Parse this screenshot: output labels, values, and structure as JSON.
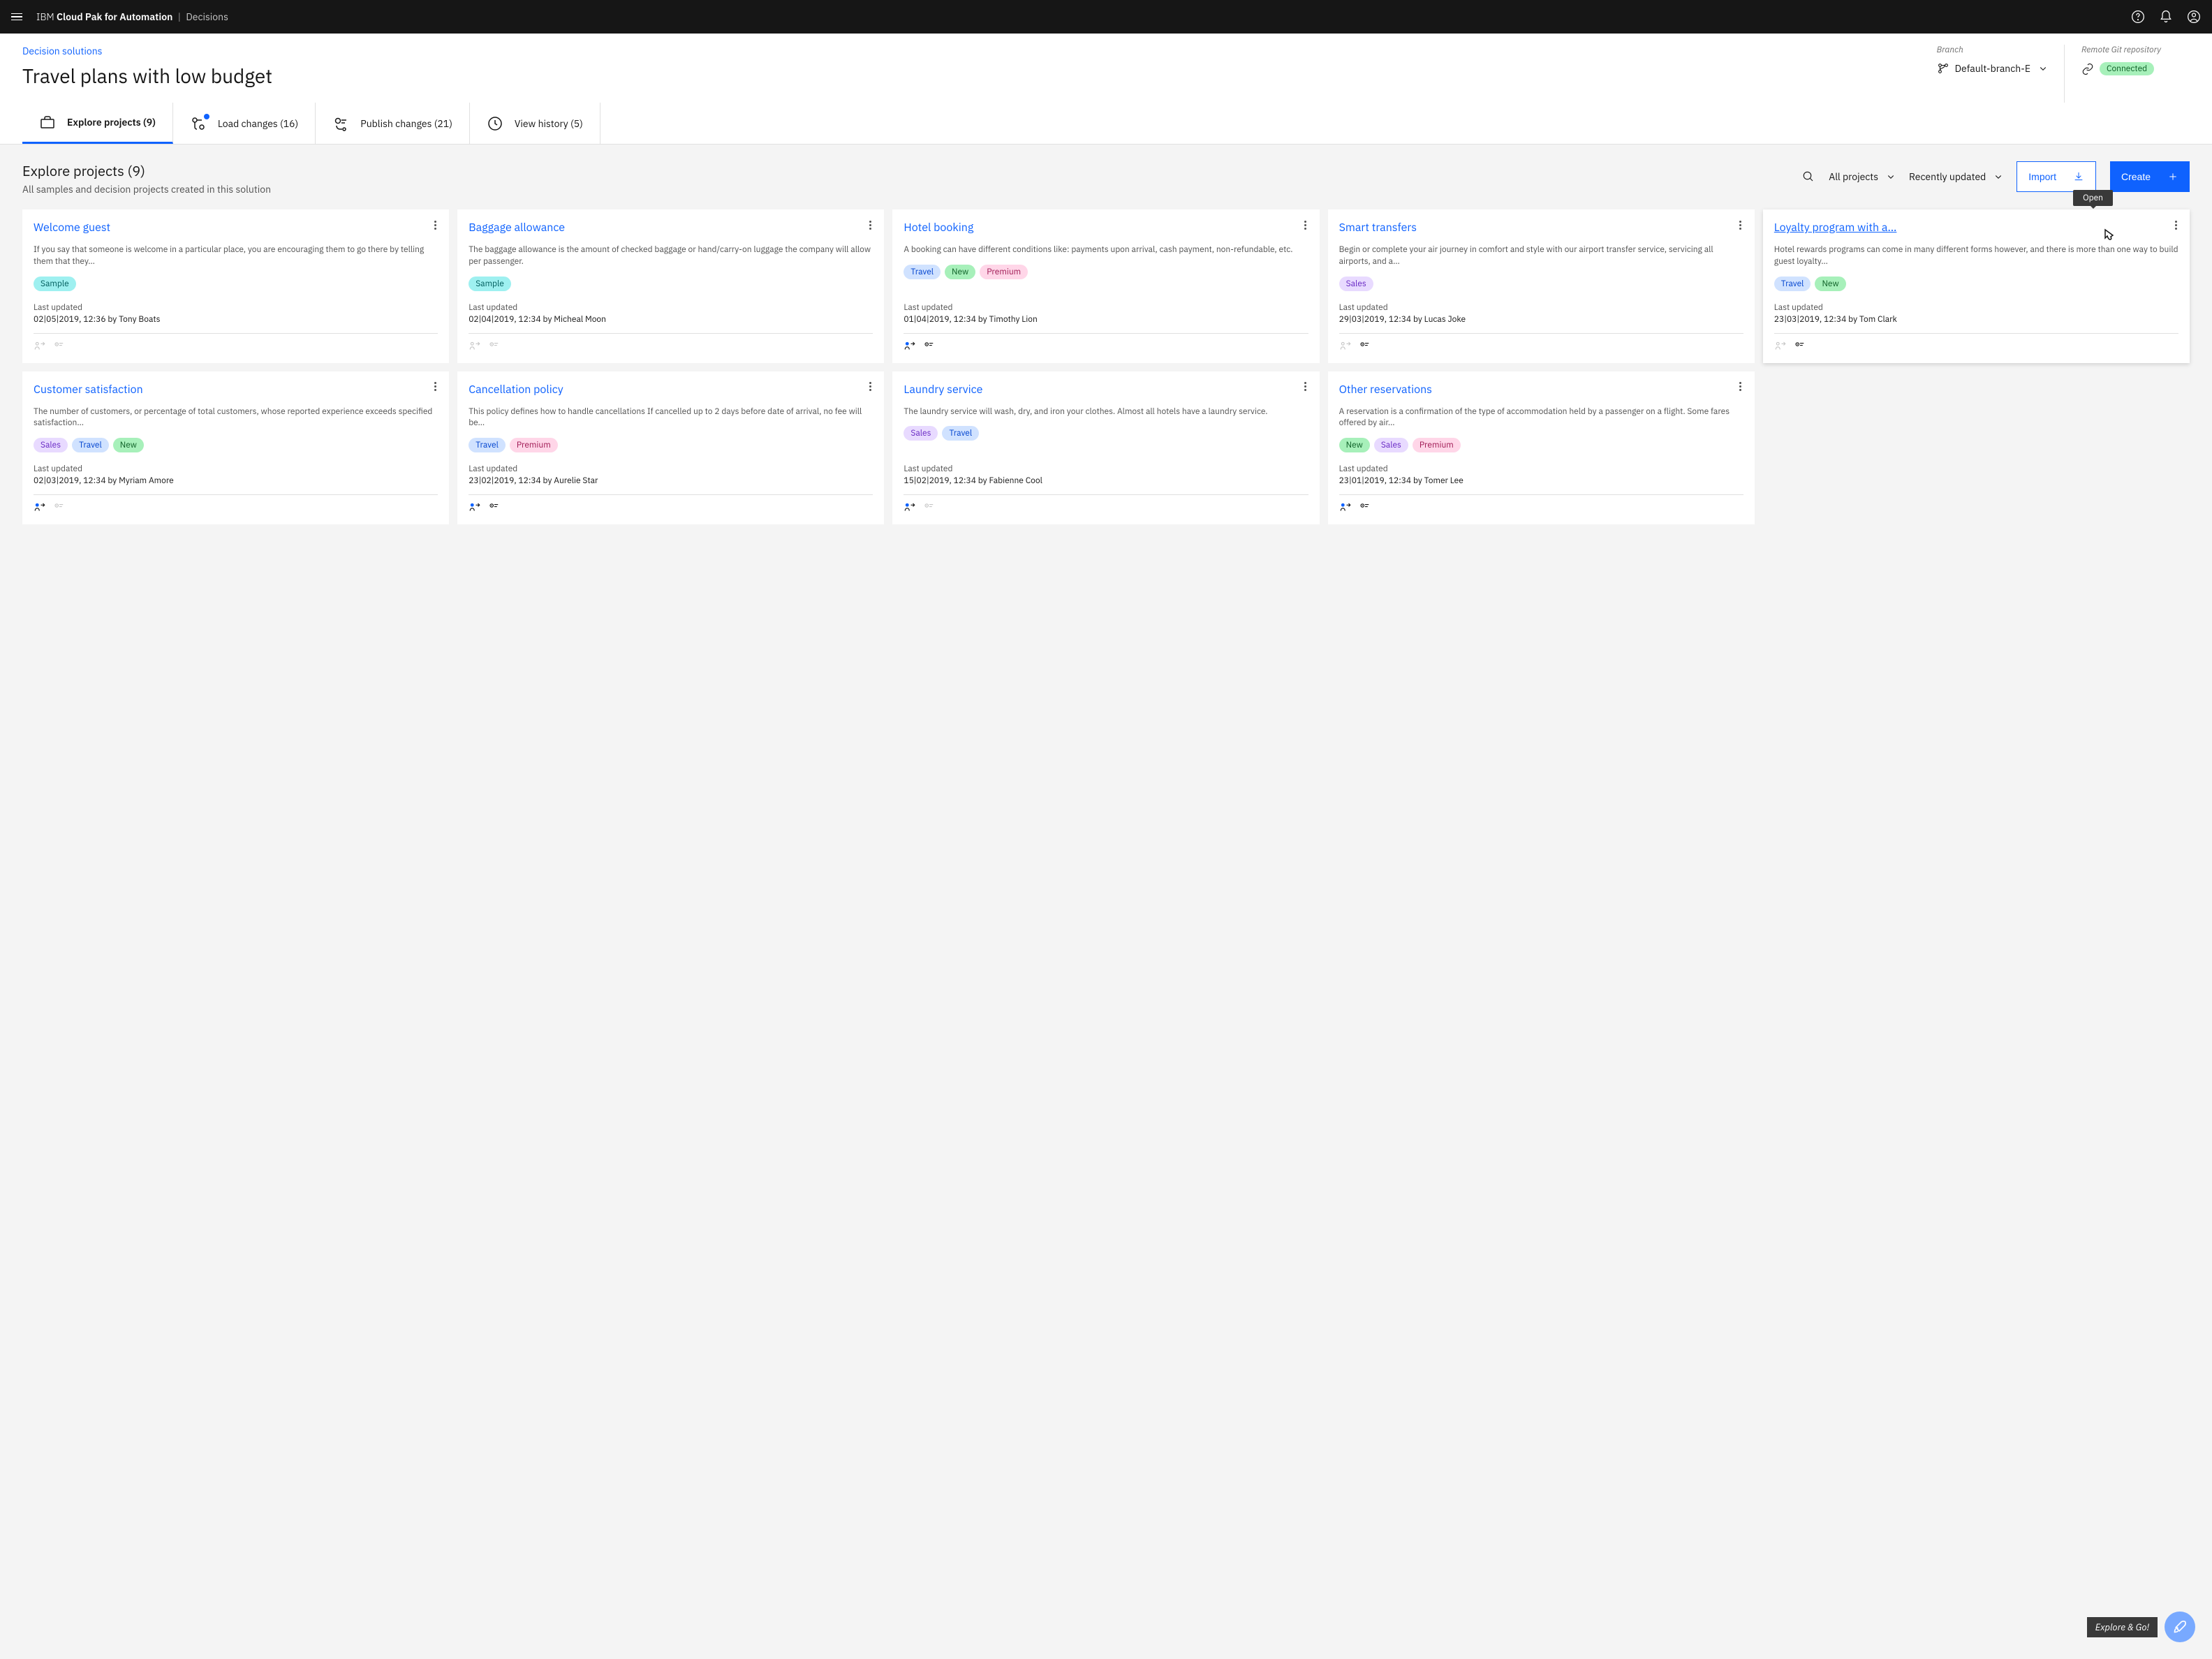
{
  "topbar": {
    "brand_prefix": "IBM",
    "brand_main": "Cloud Pak for Automation",
    "brand_sub": "Decisions"
  },
  "header": {
    "breadcrumb": "Decision solutions",
    "title": "Travel plans with low budget",
    "branch_label": "Branch",
    "branch_value": "Default-branch-E",
    "repo_label": "Remote Git repository",
    "repo_status": "Connected"
  },
  "tabs": {
    "explore": "Explore projects (9)",
    "load": "Load changes (16)",
    "publish": "Publish changes (21)",
    "history": "View history (5)"
  },
  "content": {
    "title": "Explore projects (9)",
    "subtitle": "All samples and decision projects created in this solution",
    "filter_projects": "All projects",
    "filter_sort": "Recently updated",
    "btn_import": "Import",
    "btn_create": "Create"
  },
  "tooltip": {
    "open": "Open"
  },
  "fab": {
    "label": "Explore & Go!"
  },
  "labels": {
    "last_updated": "Last updated"
  },
  "cards": [
    {
      "title": "Welcome guest",
      "desc": "If you say that someone is welcome in a particular place, you are encouraging them to go there by telling them that they…",
      "tags": [
        {
          "text": "Sample",
          "cls": "tag-sample"
        }
      ],
      "updated": "02|05|2019, 12:36 by Tony Boats",
      "icon1": "muted",
      "icon2": "muted"
    },
    {
      "title": "Baggage allowance",
      "desc": "The baggage allowance is the amount of checked baggage or hand/carry-on luggage the company will allow per passenger.",
      "tags": [
        {
          "text": "Sample",
          "cls": "tag-sample"
        }
      ],
      "updated": "02|04|2019, 12:34 by Micheal Moon",
      "icon1": "muted",
      "icon2": "muted"
    },
    {
      "title": "Hotel booking",
      "desc": "A booking can have different conditions like: payments upon arrival, cash payment, non-refundable, etc.",
      "tags": [
        {
          "text": "Travel",
          "cls": "tag-travel"
        },
        {
          "text": "New",
          "cls": "tag-new"
        },
        {
          "text": "Premium",
          "cls": "tag-premium"
        }
      ],
      "updated": "01|04|2019, 12:34 by Timothy Lion",
      "icon1": "active",
      "icon2": "active-dark"
    },
    {
      "title": "Smart transfers",
      "desc": "Begin or complete your air journey in comfort and style with our airport transfer service, servicing all airports, and a…",
      "tags": [
        {
          "text": "Sales",
          "cls": "tag-sales"
        }
      ],
      "updated": "29|03|2019, 12:34 by Lucas Joke",
      "icon1": "muted",
      "icon2": "active-dark"
    },
    {
      "title": "Loyalty program with a…",
      "desc": "Hotel rewards programs can come in many different forms however, and there is more than one way to build guest loyalty…",
      "tags": [
        {
          "text": "Travel",
          "cls": "tag-travel"
        },
        {
          "text": "New",
          "cls": "tag-new"
        }
      ],
      "updated": "23|03|2019, 12:34 by Tom Clark",
      "hover": true,
      "icon1": "muted",
      "icon2": "active-dark"
    },
    {
      "title": "Customer satisfaction",
      "desc": "The number of customers, or percentage of total customers, whose reported experience exceeds specified satisfaction…",
      "tags": [
        {
          "text": "Sales",
          "cls": "tag-sales"
        },
        {
          "text": "Travel",
          "cls": "tag-travel"
        },
        {
          "text": "New",
          "cls": "tag-new"
        }
      ],
      "updated": "02|03|2019, 12:34 by Myriam Amore",
      "icon1": "active",
      "icon2": "muted"
    },
    {
      "title": "Cancellation policy",
      "desc": "This policy defines how to handle cancellations If cancelled up to 2 days before date of arrival, no fee will be…",
      "tags": [
        {
          "text": "Travel",
          "cls": "tag-travel"
        },
        {
          "text": "Premium",
          "cls": "tag-premium"
        }
      ],
      "updated": "23|02|2019, 12:34 by Aurelie Star",
      "icon1": "active",
      "icon2": "active-dark"
    },
    {
      "title": "Laundry service",
      "desc": "The laundry service will wash, dry, and iron your clothes. Almost all hotels have a laundry service.",
      "tags": [
        {
          "text": "Sales",
          "cls": "tag-sales"
        },
        {
          "text": "Travel",
          "cls": "tag-travel"
        }
      ],
      "updated": "15|02|2019, 12:34 by Fabienne Cool",
      "icon1": "active",
      "icon2": "muted"
    },
    {
      "title": "Other reservations",
      "desc": "A reservation is a confirmation of the type of accommodation held by a passenger on a flight. Some fares offered by air…",
      "tags": [
        {
          "text": "New",
          "cls": "tag-new"
        },
        {
          "text": "Sales",
          "cls": "tag-sales"
        },
        {
          "text": "Premium",
          "cls": "tag-premium"
        }
      ],
      "updated": "23|01|2019, 12:34 by Tomer Lee",
      "icon1": "active",
      "icon2": "active-dark"
    }
  ]
}
